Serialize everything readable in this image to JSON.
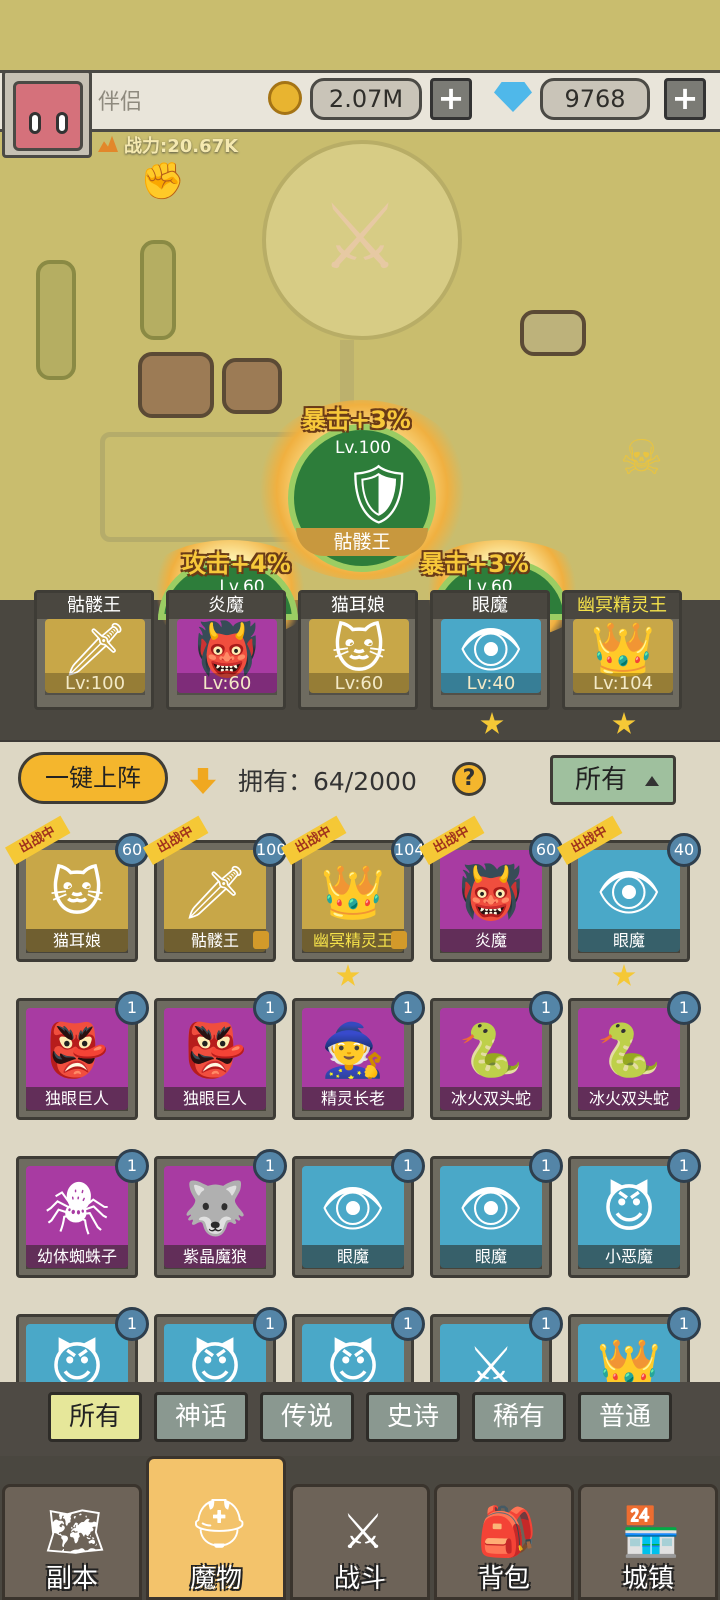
{
  "player": {
    "name": "伴侣",
    "power": "战力:20.67K",
    "gold": "2.07M",
    "gems": "9768",
    "add_label": "+"
  },
  "formation": {
    "circles": [
      {
        "bonus": "暴击+3%",
        "level": "Lv.100",
        "name": "骷髅王"
      },
      {
        "bonus": "攻击+4%",
        "level": "Lv.60"
      },
      {
        "bonus": "暴击+3%",
        "level": "Lv.60"
      }
    ],
    "slots": [
      {
        "name": "骷髅王",
        "level": "Lv:100",
        "color": "#c8a748",
        "icon": "skeleton-king"
      },
      {
        "name": "炎魔",
        "level": "Lv:60",
        "color": "#a83ba2",
        "icon": "flame-demon"
      },
      {
        "name": "猫耳娘",
        "level": "Lv:60",
        "color": "#c8a748",
        "icon": "cat-girl"
      },
      {
        "name": "眼魔",
        "level": "Lv:40",
        "color": "#4aa8c8",
        "icon": "eye-demon"
      },
      {
        "name": "幽冥精灵王",
        "level": "Lv:104",
        "color": "#c8a748",
        "icon": "nether-elf-king"
      }
    ]
  },
  "toolbar": {
    "deploy": "一键上阵",
    "owned": "拥有：64/2000",
    "help": "?",
    "filter": "所有"
  },
  "cards": [
    {
      "name": "猫耳娘",
      "level": "60",
      "tag": "出战中"
    },
    {
      "name": "骷髅王",
      "level": "100",
      "tag": "出战中"
    },
    {
      "name": "幽冥精灵王",
      "level": "104",
      "tag": "出战中"
    },
    {
      "name": "炎魔",
      "level": "60",
      "tag": "出战中"
    },
    {
      "name": "眼魔",
      "level": "40",
      "tag": "出战中"
    },
    {
      "name": "独眼巨人",
      "level": "1"
    },
    {
      "name": "独眼巨人",
      "level": "1"
    },
    {
      "name": "精灵长老",
      "level": "1"
    },
    {
      "name": "冰火双头蛇",
      "level": "1"
    },
    {
      "name": "冰火双头蛇",
      "level": "1"
    },
    {
      "name": "幼体蜘蛛子",
      "level": "1"
    },
    {
      "name": "紫晶魔狼",
      "level": "1"
    },
    {
      "name": "眼魔",
      "level": "1"
    },
    {
      "name": "眼魔",
      "level": "1"
    },
    {
      "name": "小恶魔",
      "level": "1"
    },
    {
      "level": "1"
    },
    {
      "level": "1"
    },
    {
      "level": "1"
    },
    {
      "level": "1"
    },
    {
      "level": "1"
    }
  ],
  "rarity_tabs": [
    "所有",
    "神话",
    "传说",
    "史诗",
    "稀有",
    "普通"
  ],
  "nav": [
    "副本",
    "魔物",
    "战斗",
    "背包",
    "城镇"
  ]
}
